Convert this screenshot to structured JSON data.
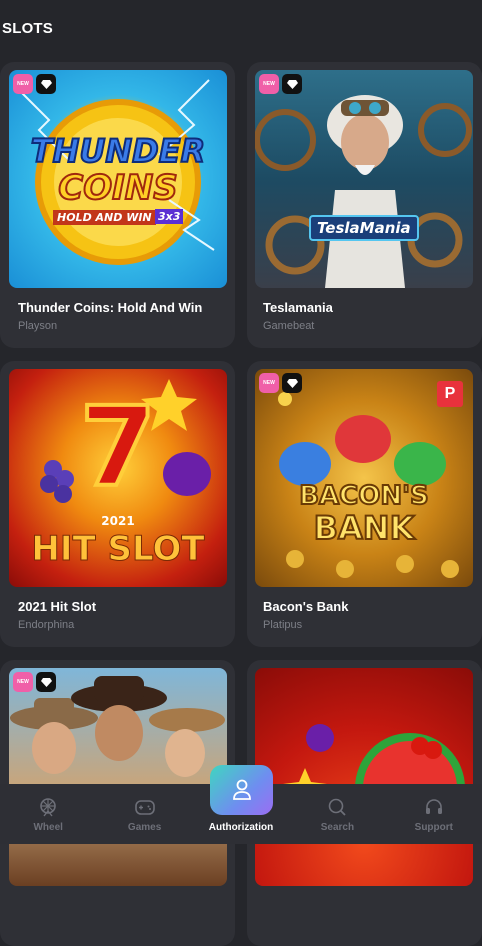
{
  "section": {
    "title": "SLOTS"
  },
  "badges": {
    "new": "NEW"
  },
  "games": [
    {
      "title": "Thunder Coins: Hold And Win",
      "provider": "Playson",
      "art_line1": "THUNDER",
      "art_line2": "COINS",
      "art_line3": "HOLD AND WIN",
      "art_tag": "3x3"
    },
    {
      "title": "Teslamania",
      "provider": "Gamebeat",
      "art_line1": "TeslaMania"
    },
    {
      "title": "2021 Hit Slot",
      "provider": "Endorphina",
      "art_line1": "7",
      "art_line2": "2021",
      "art_line3": "HIT SLOT"
    },
    {
      "title": "Bacon's Bank",
      "provider": "Platipus",
      "art_line1": "BACON'S",
      "art_line2": "BANK",
      "p_badge": "P"
    },
    {
      "title": "",
      "provider": ""
    },
    {
      "title": "",
      "provider": ""
    }
  ],
  "nav": {
    "wheel": "Wheel",
    "games": "Games",
    "authorization": "Authorization",
    "search": "Search",
    "support": "Support"
  },
  "colors": {
    "accent_from": "#3fd6c0",
    "accent_to": "#9b6df2",
    "new_badge": "#f05fa8"
  }
}
